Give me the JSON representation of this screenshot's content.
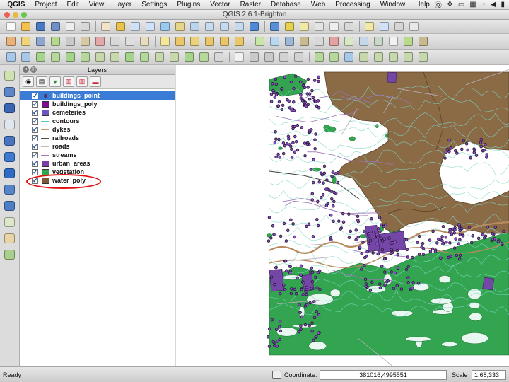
{
  "menubar": {
    "app": "QGIS",
    "items": [
      "Project",
      "Edit",
      "View",
      "Layer",
      "Settings",
      "Plugins",
      "Vector",
      "Raster",
      "Database",
      "Web",
      "Processing",
      "Window",
      "Help"
    ],
    "tray_icons": [
      "qgis-tray-icon",
      "dropbox-icon",
      "screen-icon",
      "spaces-icon",
      "wifi-icon",
      "volume-icon",
      "battery-icon"
    ]
  },
  "window": {
    "title": "QGIS 2.6.1-Brighton"
  },
  "toolbar1": [
    {
      "name": "new-project-icon",
      "color": "#fafafa"
    },
    {
      "name": "open-project-icon",
      "color": "#f2c14e"
    },
    {
      "name": "save-project-icon",
      "color": "#4a79c2"
    },
    {
      "name": "save-as-icon",
      "color": "#6f8fc7"
    },
    {
      "name": "new-print-composer-icon",
      "color": "#eeeeee"
    },
    {
      "name": "composer-manager-icon",
      "color": "#d8d8d8"
    },
    {
      "name": "sep"
    },
    {
      "name": "pan-icon",
      "color": "#f1e2c8"
    },
    {
      "name": "pan-to-selection-icon",
      "color": "#e8c34e"
    },
    {
      "name": "zoom-in-icon",
      "color": "#cfe2f7"
    },
    {
      "name": "zoom-out-icon",
      "color": "#cfe2f7"
    },
    {
      "name": "zoom-full-icon",
      "color": "#9cc9f0"
    },
    {
      "name": "zoom-to-selection-icon",
      "color": "#e6d58a"
    },
    {
      "name": "zoom-to-layer-icon",
      "color": "#b9d4ec"
    },
    {
      "name": "zoom-native-icon",
      "color": "#c8dcef"
    },
    {
      "name": "zoom-last-icon",
      "color": "#c6daef"
    },
    {
      "name": "zoom-next-icon",
      "color": "#c6daef"
    },
    {
      "name": "refresh-icon",
      "color": "#4f89d6"
    },
    {
      "name": "sep"
    },
    {
      "name": "identify-icon",
      "color": "#5790d8"
    },
    {
      "name": "select-features-icon",
      "color": "#e6d24e"
    },
    {
      "name": "deselect-icon",
      "color": "#f3e8a4"
    },
    {
      "name": "measure-icon",
      "color": "#e4e4e4"
    },
    {
      "name": "attribute-table-icon",
      "color": "#eeeeee"
    },
    {
      "name": "field-calculator-icon",
      "color": "#d9d9d9"
    },
    {
      "name": "sep"
    },
    {
      "name": "map-tips-icon",
      "color": "#f3e9a6"
    },
    {
      "name": "new-bookmark-icon",
      "color": "#cfe2f7"
    },
    {
      "name": "show-bookmarks-icon",
      "color": "#d6d6d6"
    },
    {
      "name": "text-annotation-icon",
      "color": "#e8e8e8"
    }
  ],
  "toolbar2": [
    {
      "name": "current-edits-icon",
      "color": "#e9b27a"
    },
    {
      "name": "toggle-editing-icon",
      "color": "#f0d27a"
    },
    {
      "name": "save-edits-icon",
      "color": "#8ea6cf"
    },
    {
      "name": "add-feature-icon",
      "color": "#b4d88c"
    },
    {
      "name": "move-feature-icon",
      "color": "#c9c9c9"
    },
    {
      "name": "node-tool-icon",
      "color": "#d9c8a6"
    },
    {
      "name": "delete-selected-icon",
      "color": "#e3a8a8"
    },
    {
      "name": "cut-features-icon",
      "color": "#d8d8d8"
    },
    {
      "name": "copy-features-icon",
      "color": "#dedede"
    },
    {
      "name": "paste-features-icon",
      "color": "#e8dcc0"
    },
    {
      "name": "sep"
    },
    {
      "name": "label-tool-icon",
      "color": "#f3e7a0"
    },
    {
      "name": "pin-labels-icon",
      "color": "#e9c66a"
    },
    {
      "name": "show-labels-icon",
      "color": "#ead27a"
    },
    {
      "name": "move-label-icon",
      "color": "#e9c66a"
    },
    {
      "name": "rotate-label-icon",
      "color": "#e9c66a"
    },
    {
      "name": "change-label-icon",
      "color": "#e9c66a"
    },
    {
      "name": "sep"
    },
    {
      "name": "add-vector-layer-icon",
      "color": "#c8e6a8"
    },
    {
      "name": "add-raster-layer-icon",
      "color": "#b8d8f0"
    },
    {
      "name": "add-postgis-layer-icon",
      "color": "#9db7d6"
    },
    {
      "name": "add-spatialite-layer-icon",
      "color": "#c9b98f"
    },
    {
      "name": "add-mssql-layer-icon",
      "color": "#d8d8d8"
    },
    {
      "name": "add-oracle-layer-icon",
      "color": "#e2a2a2"
    },
    {
      "name": "add-wms-layer-icon",
      "color": "#d8e8c4"
    },
    {
      "name": "add-wcs-layer-icon",
      "color": "#c4d8e8"
    },
    {
      "name": "add-wfs-layer-icon",
      "color": "#c8d8c8"
    },
    {
      "name": "add-delimited-text-icon",
      "color": "#f2f2f2"
    },
    {
      "name": "new-shapefile-icon",
      "color": "#b9d98f"
    },
    {
      "name": "new-spatialite-icon",
      "color": "#c9b98f"
    }
  ],
  "toolbar3": [
    {
      "name": "undo-icon",
      "color": "#a8c8e8"
    },
    {
      "name": "redo-icon",
      "color": "#a8c8e8"
    },
    {
      "name": "simplify-feature-icon",
      "color": "#a6d48c"
    },
    {
      "name": "add-ring-icon",
      "color": "#b6d89c"
    },
    {
      "name": "add-part-icon",
      "color": "#a6d48c"
    },
    {
      "name": "fill-ring-icon",
      "color": "#b6d89c"
    },
    {
      "name": "delete-ring-icon",
      "color": "#c6d8ac"
    },
    {
      "name": "delete-part-icon",
      "color": "#c6d8ac"
    },
    {
      "name": "reshape-features-icon",
      "color": "#a6d48c"
    },
    {
      "name": "offset-curve-icon",
      "color": "#b6d89c"
    },
    {
      "name": "split-features-icon",
      "color": "#c6d8ac"
    },
    {
      "name": "split-parts-icon",
      "color": "#c6d8ac"
    },
    {
      "name": "merge-features-icon",
      "color": "#a6d48c"
    },
    {
      "name": "merge-attributes-icon",
      "color": "#b6d89c"
    },
    {
      "name": "rotate-point-symbols-icon",
      "color": "#d8d8d8"
    },
    {
      "name": "sep"
    },
    {
      "name": "csw-icon",
      "color": "#f2f2f2"
    },
    {
      "name": "plugin-a-icon",
      "color": "#c9c9c9"
    },
    {
      "name": "plugin-b-icon",
      "color": "#c9c9c9"
    },
    {
      "name": "plugin-c-icon",
      "color": "#d2d2d2"
    },
    {
      "name": "plugin-d-icon",
      "color": "#d2d2d2"
    },
    {
      "name": "sep"
    },
    {
      "name": "digitize-a-icon",
      "color": "#b6d89c"
    },
    {
      "name": "digitize-b-icon",
      "color": "#b6d89c"
    },
    {
      "name": "digitize-c-icon",
      "color": "#a8c8e8"
    },
    {
      "name": "digitize-d-icon",
      "color": "#c6d8ac"
    },
    {
      "name": "digitize-e-icon",
      "color": "#c6d8ac"
    },
    {
      "name": "digitize-f-icon",
      "color": "#c6d8ac"
    },
    {
      "name": "digitize-g-icon",
      "color": "#c6d8ac"
    },
    {
      "name": "digitize-h-icon",
      "color": "#c6d8ac"
    }
  ],
  "leftstrip": [
    {
      "name": "add-vector-layer-icon",
      "color": "#cfe3b0"
    },
    {
      "name": "add-raster-layer-icon",
      "color": "#5d86c9"
    },
    {
      "name": "add-postgis-layer-icon",
      "color": "#3a65b2"
    },
    {
      "name": "add-spatialite-layer-icon",
      "color": "#e0e6ee"
    },
    {
      "name": "add-mssql-layer-icon",
      "color": "#4a74c0"
    },
    {
      "name": "add-wms-layer-icon",
      "color": "#3d7ad0"
    },
    {
      "name": "add-wcs-layer-icon",
      "color": "#2f6bc4"
    },
    {
      "name": "add-wfs-layer-icon",
      "color": "#5584c9"
    },
    {
      "name": "add-delimited-text-icon",
      "color": "#4e7fc6"
    },
    {
      "name": "new-shapefile-icon",
      "color": "#dce6c8"
    },
    {
      "name": "gps-tools-icon",
      "color": "#e8d4a4"
    },
    {
      "name": "georeferencer-icon",
      "color": "#a8d08c"
    }
  ],
  "layers_panel": {
    "title": "Layers",
    "buttons": [
      "eye-icon",
      "add-group-icon",
      "filter-icon",
      "expand-all-icon",
      "collapse-all-icon",
      "remove-layer-icon"
    ],
    "items": [
      {
        "label": "buildings_point",
        "checked": "✓",
        "symbol": "dot",
        "color": "#6b2e9a",
        "selected": true
      },
      {
        "label": "buildings_poly",
        "checked": "✓",
        "symbol": "fill",
        "color": "#7d0f8c"
      },
      {
        "label": "cemeteries",
        "checked": "✓",
        "symbol": "fill",
        "color": "#6a55c2"
      },
      {
        "label": "contours",
        "checked": "✓",
        "symbol": "line",
        "color": "#58c8b8"
      },
      {
        "label": "dykes",
        "checked": "✓",
        "symbol": "line",
        "color": "#c89a6a"
      },
      {
        "label": "railroads",
        "checked": "✓",
        "symbol": "line",
        "color": "#4d4d4d"
      },
      {
        "label": "roads",
        "checked": "✓",
        "symbol": "line",
        "color": "#c2b8b8"
      },
      {
        "label": "streams",
        "checked": "✓",
        "symbol": "line",
        "color": "#a47cb8"
      },
      {
        "label": "urban_areas",
        "checked": "✓",
        "symbol": "fill",
        "color": "#7a3fa6"
      },
      {
        "label": "vegetation",
        "checked": "✓",
        "symbol": "fill",
        "color": "#31a64a"
      },
      {
        "label": "water_poly",
        "checked": "✓",
        "symbol": "fill",
        "color": "#7d5a38"
      }
    ]
  },
  "map": {
    "colors": {
      "water": "#8b6b46",
      "vegetation": "#33a550",
      "urban": "#7446a6",
      "building": "#2b1b3a",
      "point_fill": "#8f4ccf",
      "contour": "#7fd6c4",
      "road": "#b7aeb4",
      "stream": "#9874b6",
      "dyke": "#b88a5e",
      "railroad": "#404040"
    }
  },
  "statusbar": {
    "ready": "Ready",
    "coordinate_label": "Coordinate:",
    "coordinate_value": "381016,4995551",
    "scale_label": "Scale",
    "scale_value": "1:68,333"
  }
}
